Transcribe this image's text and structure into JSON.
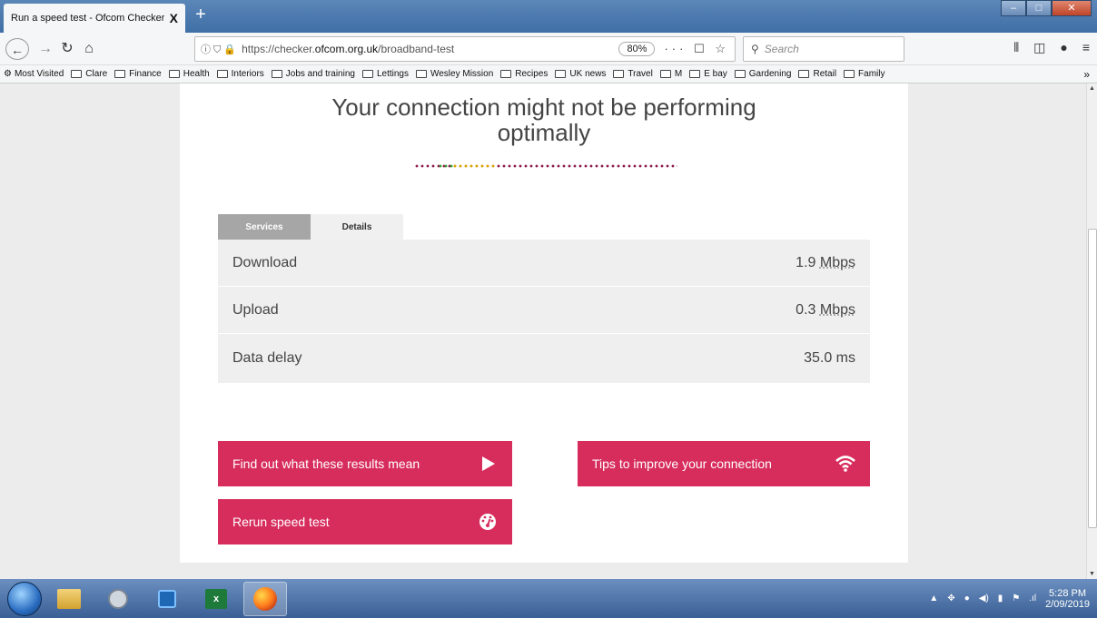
{
  "browser": {
    "tab_title": "Run a speed test - Ofcom Checker",
    "tab_close": "X",
    "new_tab": "+",
    "url_prefix": "https://checker.",
    "url_domain": "ofcom.org.uk",
    "url_path": "/broadband-test",
    "zoom": "80%",
    "search_placeholder": "Search"
  },
  "bookmarks": {
    "most_visited": "Most Visited",
    "folders": [
      "Clare",
      "Finance",
      "Health",
      "Interiors",
      "Jobs and training",
      "Lettings",
      "Wesley Mission",
      "Recipes",
      "UK news",
      "Travel",
      "M",
      "E bay",
      "Gardening",
      "Retail",
      "Family"
    ]
  },
  "page": {
    "headline_line1": "Your connection might not be performing",
    "headline_line2": "optimally",
    "tabs": {
      "services": "Services",
      "details": "Details"
    },
    "results": [
      {
        "label": "Download",
        "value": "1.9",
        "unit": "Mbps"
      },
      {
        "label": "Upload",
        "value": "0.3",
        "unit": "Mbps"
      },
      {
        "label": "Data delay",
        "value": "35.0",
        "unit": "ms"
      }
    ],
    "buttons": {
      "results_meaning": "Find out what these results mean",
      "tips": "Tips to improve your connection",
      "rerun": "Rerun speed test"
    },
    "accent_color": "#d72d5d"
  },
  "taskbar": {
    "time": "5:28 PM",
    "date": "2/09/2019",
    "excel_label": "x"
  }
}
